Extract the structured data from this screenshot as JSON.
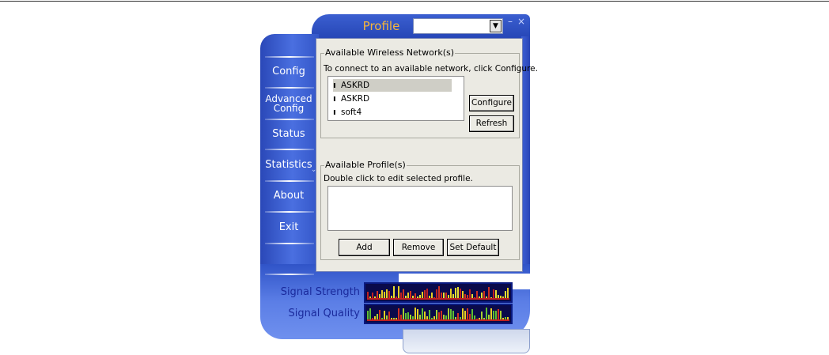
{
  "window": {
    "title": "Profile",
    "profile_select_value": "",
    "minimize_glyph": "–",
    "close_glyph": "×"
  },
  "sidebar": {
    "items": [
      {
        "id": "config",
        "label": "Config"
      },
      {
        "id": "advanced",
        "label": "Advanced\nConfig"
      },
      {
        "id": "status",
        "label": "Status"
      },
      {
        "id": "statistics",
        "label": "Statistics"
      },
      {
        "id": "about",
        "label": "About"
      },
      {
        "id": "exit",
        "label": "Exit"
      }
    ]
  },
  "networks_group": {
    "title": "Available Wireless Network(s)",
    "hint": "To connect to an available network, click Configure.",
    "networks": [
      {
        "ssid": "ASKRD",
        "selected": true
      },
      {
        "ssid": "ASKRD",
        "selected": false
      },
      {
        "ssid": "soft4",
        "selected": false
      }
    ],
    "configure_label": "Configure",
    "refresh_label": "Refresh"
  },
  "profiles_group": {
    "title": "Available Profile(s)",
    "hint": "Double click to edit selected profile.",
    "add_label": "Add",
    "remove_label": "Remove",
    "set_default_label": "Set Default"
  },
  "signal": {
    "strength_label": "Signal Strength",
    "quality_label": "Signal Quality"
  },
  "colors": {
    "skin_blue": "#2f4fc0",
    "title_orange": "#f5b53a",
    "signal_text": "#1a2a9c",
    "meter_bg": "#0a0a4a"
  }
}
